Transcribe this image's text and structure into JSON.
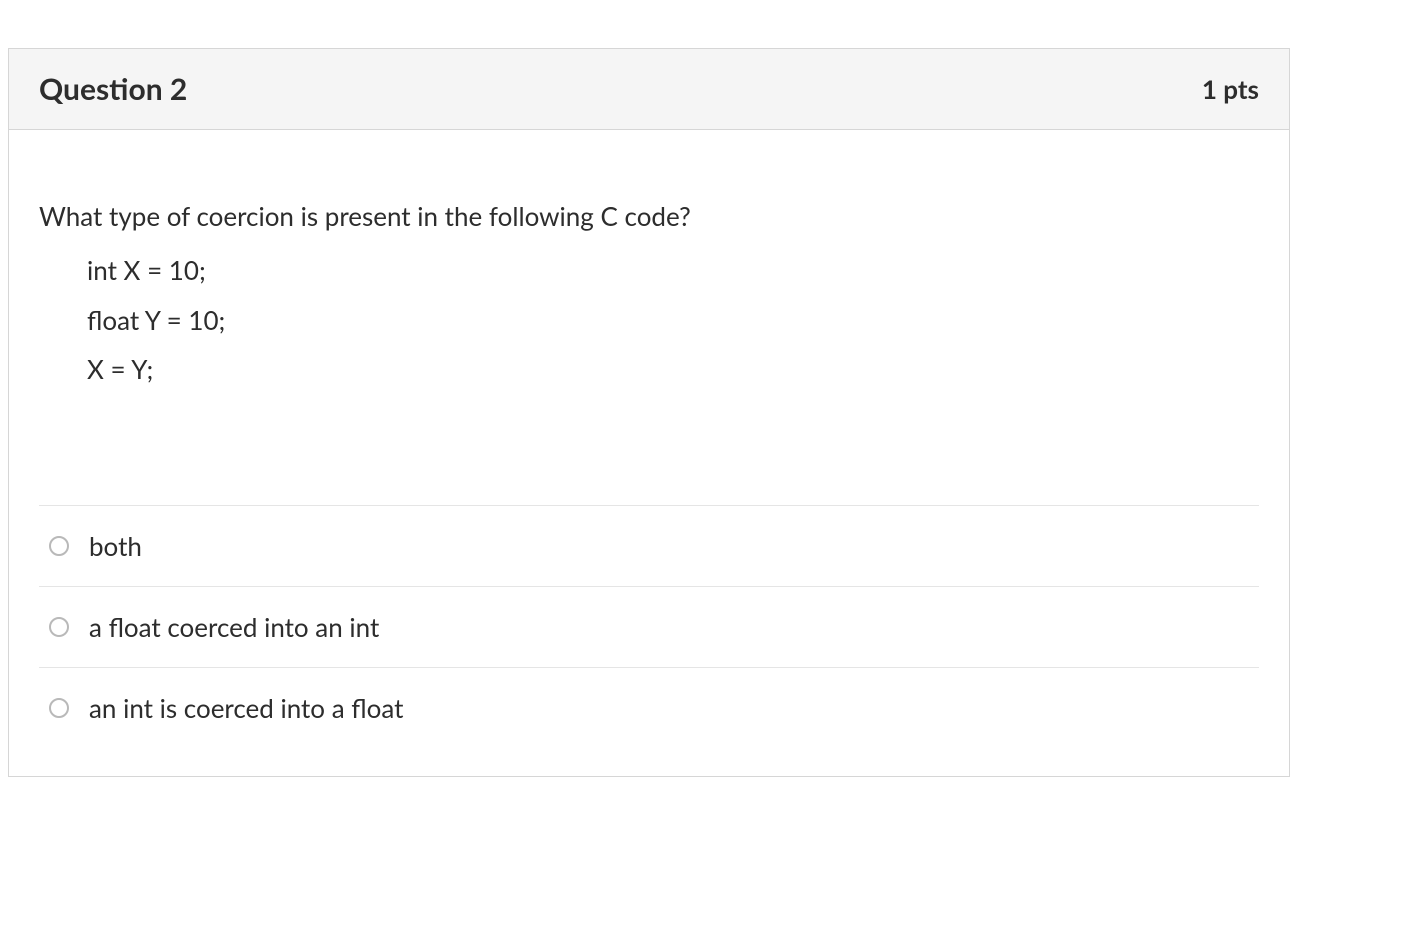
{
  "question": {
    "title": "Question 2",
    "points": "1 pts",
    "prompt": "What type of coercion is present in the following C code?",
    "code": {
      "line1": "int X = 10;",
      "line2": "float Y = 10;",
      "line3": "X = Y;"
    },
    "answers": [
      {
        "label": "both"
      },
      {
        "label": "a float coerced into an int"
      },
      {
        "label": "an int is coerced into a float"
      }
    ]
  }
}
